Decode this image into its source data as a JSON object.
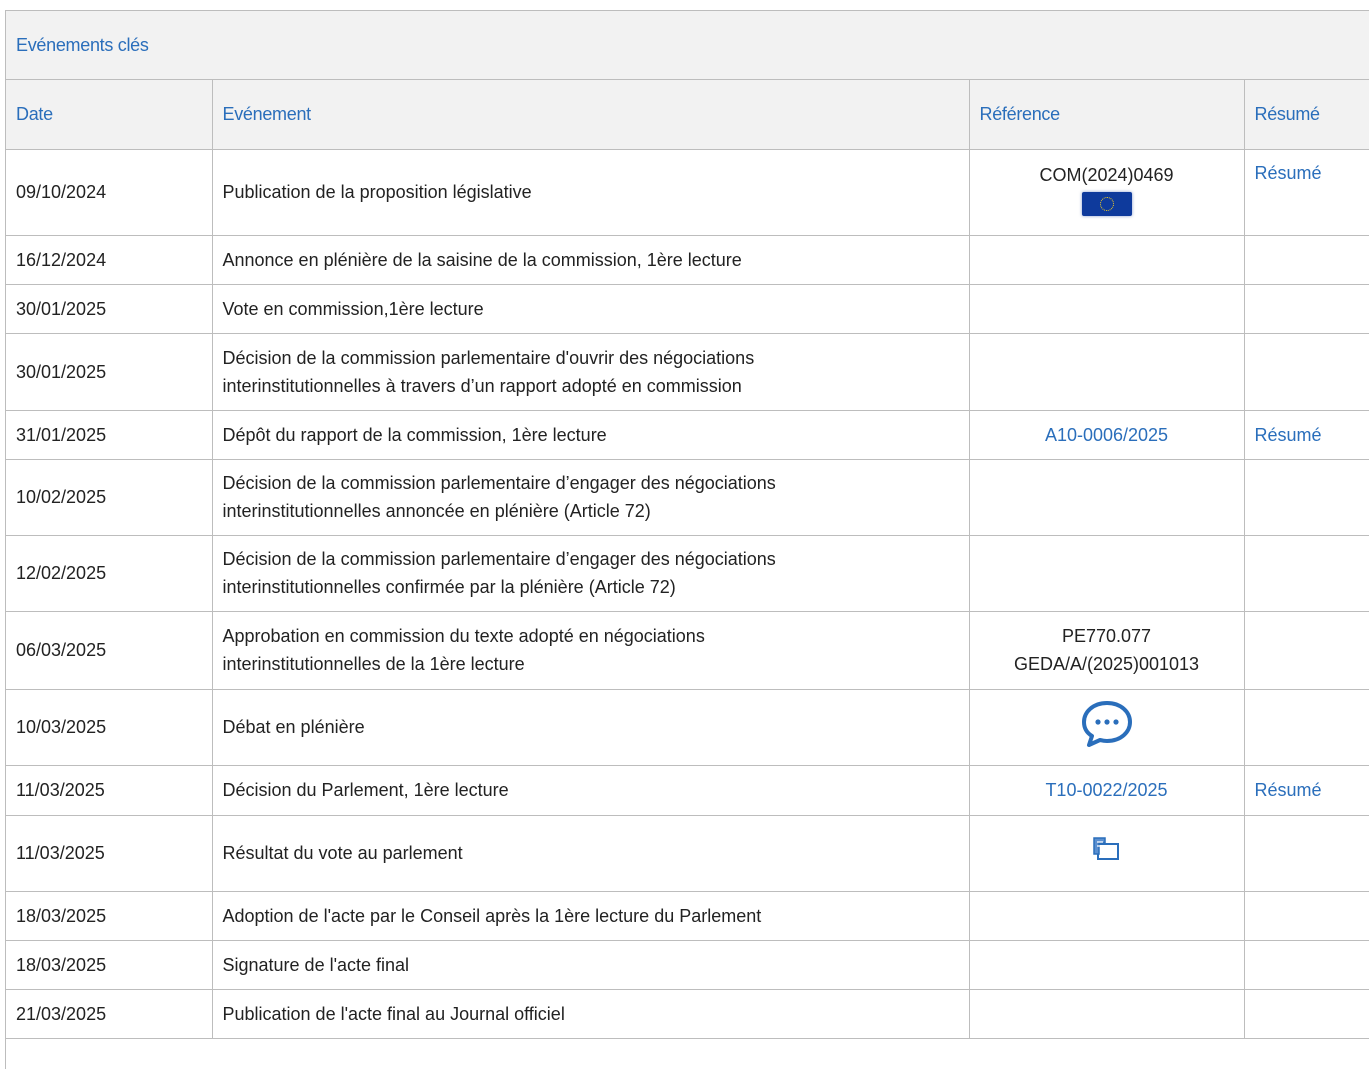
{
  "panel": {
    "title": "Evénements clés"
  },
  "columns": {
    "date": "Date",
    "event": "Evénement",
    "reference": "Référence",
    "summary": "Résumé"
  },
  "icons": {
    "eu_flag": "eu-flag-icon",
    "debate": "speech-bubble-icon",
    "vote": "vote-result-icon"
  },
  "colors": {
    "link": "#2a6ebb",
    "header_bg": "#f2f2f2",
    "border": "#bdbdbd"
  },
  "rows": [
    {
      "date": "09/10/2024",
      "event": "Publication de la proposition législative",
      "ref": "COM(2024)0469",
      "ref_icon": "eu-flag-icon",
      "summary": "Résumé"
    },
    {
      "date": "16/12/2024",
      "event": "Annonce en plénière de la saisine de la commission, 1ère lecture"
    },
    {
      "date": "30/01/2025",
      "event": "Vote en commission,1ère lecture"
    },
    {
      "date": "30/01/2025",
      "event_line1": "Décision de la commission parlementaire d'ouvrir des négociations",
      "event_line2": "interinstitutionnelles à travers d’un rapport adopté en commission"
    },
    {
      "date": "31/01/2025",
      "event": "Dépôt du rapport de la commission, 1ère lecture",
      "ref_link": "A10-0006/2025",
      "summary": "Résumé"
    },
    {
      "date": "10/02/2025",
      "event_line1": "Décision de la commission parlementaire d’engager des négociations",
      "event_line2": "interinstitutionnelles annoncée en plénière (Article 72)"
    },
    {
      "date": "12/02/2025",
      "event_line1": "Décision de la commission parlementaire d’engager des négociations",
      "event_line2": "interinstitutionnelles confirmée par la plénière (Article 72)"
    },
    {
      "date": "06/03/2025",
      "event_line1": "Approbation en commission du texte adopté en négociations",
      "event_line2": "interinstitutionnelles de la 1ère lecture",
      "ref_line1": "PE770.077",
      "ref_line2": "GEDA/A/(2025)001013"
    },
    {
      "date": "10/03/2025",
      "event": "Débat en plénière",
      "ref_icon": "speech-bubble-icon"
    },
    {
      "date": "11/03/2025",
      "event": "Décision du Parlement, 1ère lecture",
      "ref_link": "T10-0022/2025",
      "summary": "Résumé"
    },
    {
      "date": "11/03/2025",
      "event": "Résultat du vote au parlement",
      "ref_icon": "vote-result-icon"
    },
    {
      "date": "18/03/2025",
      "event": "Adoption de l'acte par le Conseil après la 1ère lecture du Parlement"
    },
    {
      "date": "18/03/2025",
      "event": "Signature de l'acte final"
    },
    {
      "date": "21/03/2025",
      "event": "Publication de l'acte final au Journal officiel"
    }
  ]
}
